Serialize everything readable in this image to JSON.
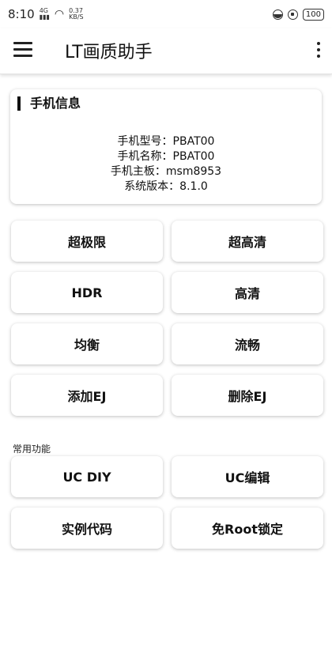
{
  "status_bar": {
    "time": "8:10",
    "network_label": "4G",
    "speed_value": "0.37",
    "speed_unit": "KB/S",
    "battery": "100"
  },
  "app_bar": {
    "title": "LT画质助手"
  },
  "info_card": {
    "title": "手机信息",
    "lines": [
      "手机型号：PBAT00",
      "手机名称：PBAT00",
      "手机主板：msm8953",
      "系统版本：8.1.0"
    ]
  },
  "buttons": {
    "ultra_extreme": "超极限",
    "ultra_hd": "超高清",
    "hdr": "HDR",
    "hd": "高清",
    "balanced": "均衡",
    "smooth": "流畅",
    "add_ej": "添加EJ",
    "delete_ej": "删除EJ"
  },
  "common_section": {
    "label": "常用功能",
    "uc_diy": "UC DIY",
    "uc_edit": "UC编辑",
    "example_code": "实例代码",
    "root_free_lock": "免Root锁定"
  }
}
